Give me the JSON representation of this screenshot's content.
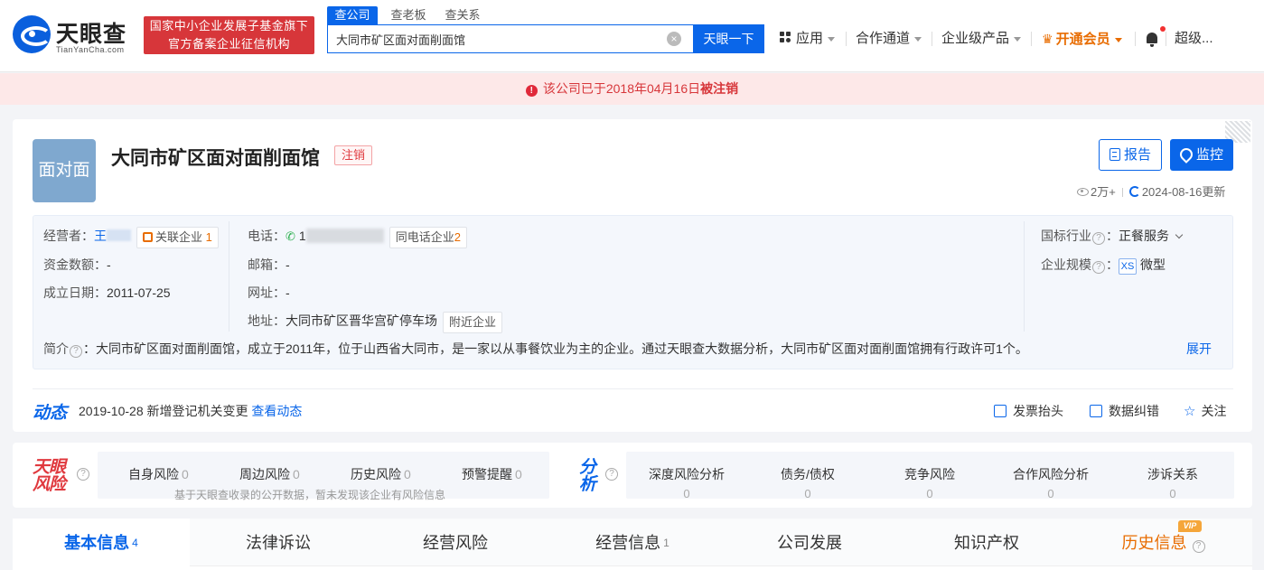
{
  "header": {
    "logo_name": "天眼查",
    "logo_domain": "TianYanCha.com",
    "gov_badge_line1": "国家中小企业发展子基金旗下",
    "gov_badge_line2": "官方备案企业征信机构",
    "search_tabs": [
      "查公司",
      "查老板",
      "查关系"
    ],
    "search_value": "大同市矿区面对面削面馆",
    "search_button": "天眼一下",
    "nav": {
      "apps": "应用",
      "cooperation": "合作通道",
      "enterprise": "企业级产品",
      "vip": "开通会员",
      "user": "超级..."
    }
  },
  "alert": {
    "prefix": "该公司已于2018年04月16日",
    "strong": "被注销"
  },
  "company": {
    "logo_text": "面对面",
    "name": "大同市矿区面对面削面馆",
    "status": "注销",
    "report_button": "报告",
    "monitor_button": "监控",
    "views": "2万+",
    "updated": "2024-08-16更新",
    "operator_label": "经营者：",
    "operator_name": "王",
    "related_label": "关联企业",
    "related_count": "1",
    "capital_label": "资金数额：",
    "capital_value": "-",
    "founded_label": "成立日期：",
    "founded_value": "2011-07-25",
    "phone_label": "电话：",
    "phone_value": "1",
    "same_phone_label": "同电话企业",
    "same_phone_count": "2",
    "email_label": "邮箱：",
    "email_value": "-",
    "website_label": "网址：",
    "website_value": "-",
    "address_label": "地址：",
    "address_value": "大同市矿区晋华宫矿停车场",
    "nearby_button": "附近企业",
    "industry_label": "国标行业",
    "industry_value": "正餐服务",
    "scale_label": "企业规模",
    "scale_badge": "XS",
    "scale_value": "微型",
    "intro_label": "简介",
    "intro_text": "：大同市矿区面对面削面馆，成立于2011年，位于山西省大同市，是一家以从事餐饮业为主的企业。通过天眼查大数据分析，大同市矿区面对面削面馆拥有行政许可1个。",
    "expand": "展开"
  },
  "dynamics": {
    "title": "动态",
    "text": "2019-10-28 新增登记机关变更",
    "link": "查看动态",
    "invoice": "发票抬头",
    "correction": "数据纠错",
    "follow": "关注"
  },
  "risk": {
    "logo_line1": "天眼",
    "logo_line2": "风险",
    "items": [
      {
        "label": "自身风险",
        "count": "0"
      },
      {
        "label": "周边风险",
        "count": "0"
      },
      {
        "label": "历史风险",
        "count": "0"
      },
      {
        "label": "预警提醒",
        "count": "0"
      }
    ],
    "note": "基于天眼查收录的公开数据，暂未发现该企业有风险信息"
  },
  "analysis": {
    "logo_line1": "分",
    "logo_line2": "析",
    "items": [
      {
        "label": "深度风险分析",
        "count": "0"
      },
      {
        "label": "债务/债权",
        "count": "0"
      },
      {
        "label": "竞争风险",
        "count": "0"
      },
      {
        "label": "合作风险分析",
        "count": "0"
      },
      {
        "label": "涉诉关系",
        "count": "0"
      }
    ]
  },
  "tabs": [
    {
      "label": "基本信息",
      "count": "4"
    },
    {
      "label": "法律诉讼",
      "count": ""
    },
    {
      "label": "经营风险",
      "count": ""
    },
    {
      "label": "经营信息",
      "count": "1"
    },
    {
      "label": "公司发展",
      "count": ""
    },
    {
      "label": "知识产权",
      "count": ""
    },
    {
      "label": "历史信息",
      "count": ""
    }
  ],
  "vip_badge": "VIP",
  "colors": {
    "brand_blue": "#0a66e9",
    "alert_red": "#d7363a",
    "vip_orange": "#e86c00"
  }
}
